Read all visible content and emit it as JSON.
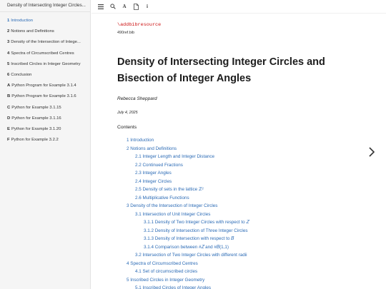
{
  "sidebar": {
    "title": "Density of Intersecting Integer Circles...",
    "items": [
      {
        "num": "1",
        "label": "Introduction",
        "active": true
      },
      {
        "num": "2",
        "label": "Notions and Definitions"
      },
      {
        "num": "3",
        "label": "Density of the Intersection of Intege..."
      },
      {
        "num": "4",
        "label": "Spectra of Circumscribed Centres"
      },
      {
        "num": "5",
        "label": "Inscribed Circles in Integer Geometry"
      },
      {
        "num": "6",
        "label": "Conclusion"
      },
      {
        "num": "A",
        "label": "Python Program for Example 3.1.4"
      },
      {
        "num": "B",
        "label": "Python Program for Example 3.1.6"
      },
      {
        "num": "C",
        "label": "Python for Example 3.1.15"
      },
      {
        "num": "D",
        "label": "Python for Example 3.1.16"
      },
      {
        "num": "E",
        "label": "Python for Example 3.1.20"
      },
      {
        "num": "F",
        "label": "Python for Example 3.2.2"
      }
    ]
  },
  "toolbar": {
    "menu_icon": "≡",
    "search_icon": "search",
    "font_icon": "A",
    "pdf_icon": "pdf",
    "info_icon": "i"
  },
  "doc": {
    "bibresource": "\\addbibresource",
    "bibfile": "490ref.bib",
    "title_line1": "Density of Intersecting Integer Circles and",
    "title_line2": "Bisection of Integer Angles",
    "author": "Rebecca Sheppard",
    "date": "July 4, 2025",
    "contents_heading": "Contents"
  },
  "toc": [
    {
      "level": 0,
      "text": "1 Introduction"
    },
    {
      "level": 0,
      "text": "2 Notions and Definitions"
    },
    {
      "level": 1,
      "text": "2.1 Integer Length and Integer Distance"
    },
    {
      "level": 1,
      "text": "2.2 Continued Fractions"
    },
    {
      "level": 1,
      "text": "2.3 Integer Angles"
    },
    {
      "level": 1,
      "text": "2.4 Integer Circles"
    },
    {
      "level": 1,
      "text": "2.5 Density of sets in the lattice ℤ²"
    },
    {
      "level": 1,
      "text": "2.6 Multiplicative Functions"
    },
    {
      "level": 0,
      "text": "3 Density of the Intersection of Integer Circles"
    },
    {
      "level": 1,
      "text": "3.1 Intersection of Unit Integer Circles"
    },
    {
      "level": 2,
      "text": "3.1.1 Density of Two Integer Circles with respect to 𝑍"
    },
    {
      "level": 2,
      "text": "3.1.2 Density of Intersection of Three Integer Circles"
    },
    {
      "level": 2,
      "text": "3.1.3 Density of Intersection with respect to 𝐵"
    },
    {
      "level": 2,
      "text": "3.1.4 Comparison between #𝑍 and #𝐵(1,1)"
    },
    {
      "level": 1,
      "text": "3.2 Intersection of Two Integer Circles with different radii"
    },
    {
      "level": 0,
      "text": "4 Spectra of Circumscribed Centres"
    },
    {
      "level": 1,
      "text": "4.1 Set of circumscribed circles"
    },
    {
      "level": 0,
      "text": "5 Inscribed Circles in Integer Geometry"
    },
    {
      "level": 1,
      "text": "5.1 Inscribed Circles of Integer Angles"
    }
  ],
  "nav": {
    "next_icon": "chevron-right"
  }
}
